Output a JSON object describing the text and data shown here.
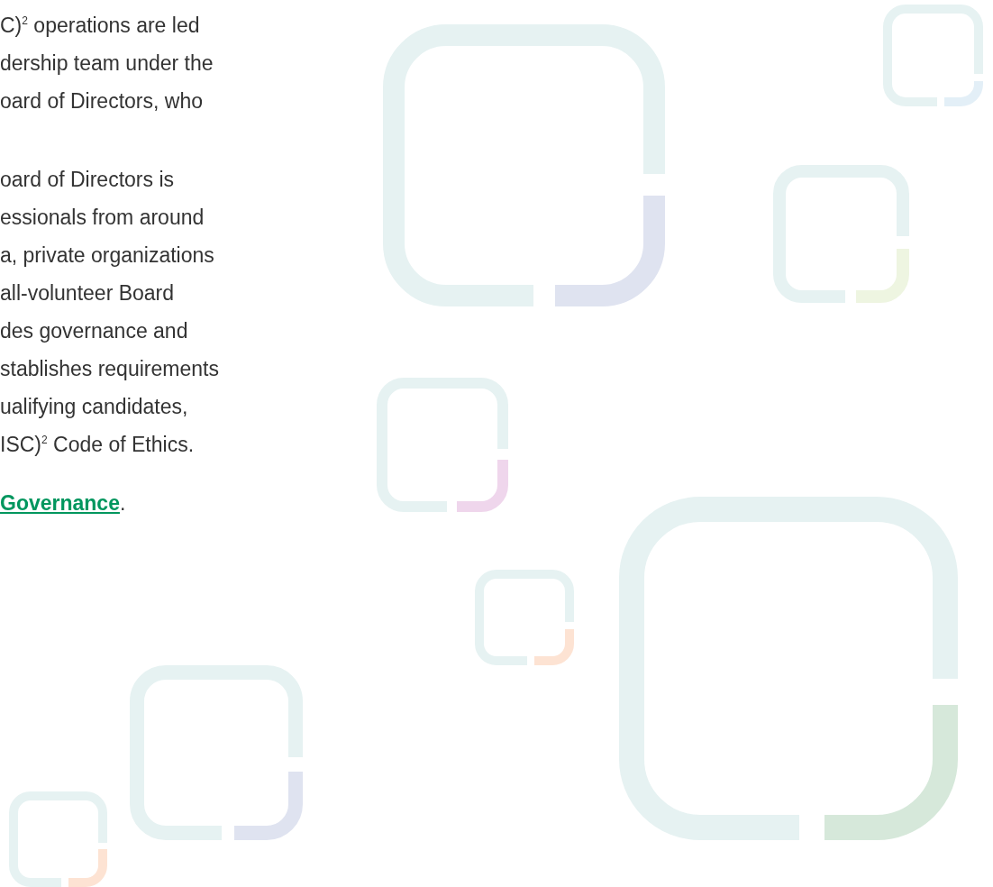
{
  "paragraphs": [
    {
      "lines": [
        "C)$^{2}$ operations are led",
        "dership team under the",
        "oard of Directors, who"
      ]
    },
    {
      "lines": [
        "oard of Directors is",
        "essionals from around",
        "a, private organizations",
        "all-volunteer Board",
        "des governance and",
        "stablishes requirements",
        "ualifying candidates,",
        "ISC)$^{2}$ Code of Ethics."
      ]
    }
  ],
  "link_line": {
    "link": "Governance",
    "tail": "."
  }
}
